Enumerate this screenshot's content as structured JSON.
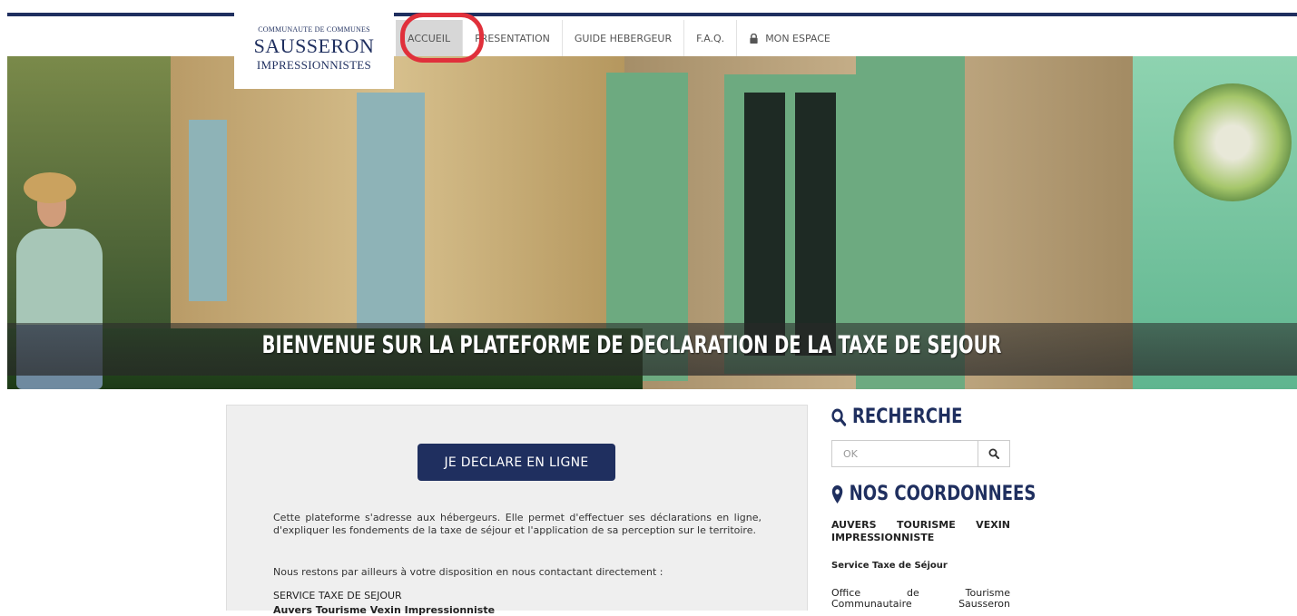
{
  "logo": {
    "line1": "COMMUNAUTE DE COMMUNES",
    "line2": "SAUSSERON",
    "line3": "IMPRESSIONNISTES"
  },
  "nav": {
    "items": [
      {
        "label": "ACCUEIL",
        "active": true
      },
      {
        "label": "PRESENTATION"
      },
      {
        "label": "GUIDE HEBERGEUR"
      },
      {
        "label": "F.A.Q."
      },
      {
        "label": "MON ESPACE",
        "icon": "lock-icon"
      }
    ]
  },
  "hero": {
    "banner": "BIENVENUE SUR LA PLATEFORME DE DECLARATION DE LA TAXE DE SEJOUR"
  },
  "main": {
    "cta_label": "JE DECLARE EN LIGNE",
    "paragraph1": "Cette plateforme s'adresse aux hébergeurs. Elle permet d'effectuer ses déclarations en ligne, d'expliquer les fondements de la taxe de séjour et l'application de sa perception sur le territoire.",
    "paragraph2": "Nous restons par ailleurs à votre disposition en nous contactant directement :",
    "service": "SERVICE TAXE DE SEJOUR",
    "service_org": "Auvers Tourisme Vexin Impressionniste"
  },
  "sidebar": {
    "search": {
      "title": "RECHERCHE",
      "placeholder": "OK",
      "icon": "search-icon"
    },
    "contact": {
      "title": "NOS COORDONNEES",
      "icon": "map-marker-icon",
      "org_line1": "AUVERS TOURISME VEXIN",
      "org_line2": "IMPRESSIONNISTE",
      "service": "Service Taxe de Séjour",
      "office_w1": "Office",
      "office_w2": "de",
      "office_w3": "Tourisme",
      "office_w4": "Communautaire",
      "office_w5": "Sausseron"
    }
  },
  "colors": {
    "brand": "#1f2f5f",
    "highlight": "#e0303b",
    "nav_active": "#d7d7d7"
  }
}
